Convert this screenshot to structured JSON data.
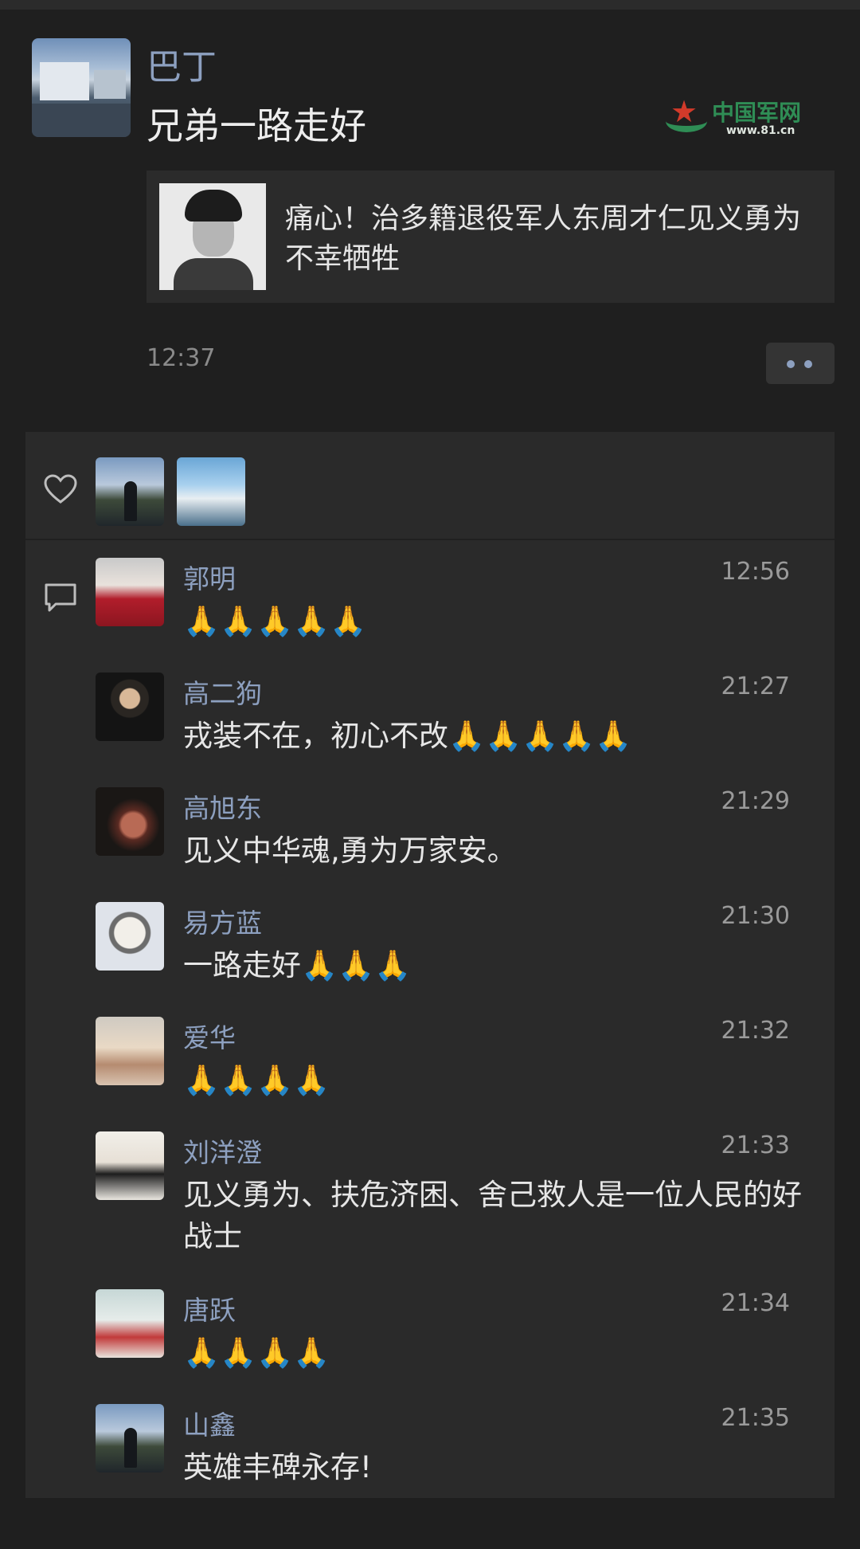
{
  "post": {
    "poster_name": "巴丁",
    "text": "兄弟一路走好",
    "time": "12:37",
    "watermark": {
      "title": "中国军网",
      "url": "www.81.cn"
    },
    "shared_article": {
      "title": "痛心！治多籍退役军人东周才仁见义勇为不幸牺牲"
    }
  },
  "likes": {
    "icon": "heart-icon",
    "count": 2
  },
  "comments": [
    {
      "name": "郭明",
      "time": "12:56",
      "text": "🙏🙏🙏🙏🙏",
      "avatar": "av-guoming"
    },
    {
      "name": "高二狗",
      "time": "21:27",
      "text": "戎装不在，初心不改🙏🙏🙏🙏🙏",
      "avatar": "av-gao2"
    },
    {
      "name": "高旭东",
      "time": "21:29",
      "text": "见义中华魂,勇为万家安。",
      "avatar": "av-gaoxd"
    },
    {
      "name": "易方蓝",
      "time": "21:30",
      "text": "一路走好🙏🙏🙏",
      "avatar": "av-yifl"
    },
    {
      "name": "爱华",
      "time": "21:32",
      "text": "🙏🙏🙏🙏",
      "avatar": "av-aihua"
    },
    {
      "name": "刘洋澄",
      "time": "21:33",
      "text": "见义勇为、扶危济困、舍己救人是一位人民的好战士",
      "avatar": "av-liuyc"
    },
    {
      "name": "唐跃",
      "time": "21:34",
      "text": "🙏🙏🙏🙏",
      "avatar": "av-tangy"
    },
    {
      "name": "山鑫",
      "time": "21:35",
      "text": "英雄丰碑永存!",
      "avatar": "av-shanx"
    }
  ],
  "colors": {
    "background": "#1f1f1f",
    "panel": "#2a2a2a",
    "name_link": "#8da0c0",
    "text": "#e6e6e6",
    "muted": "#8a8a8a"
  }
}
